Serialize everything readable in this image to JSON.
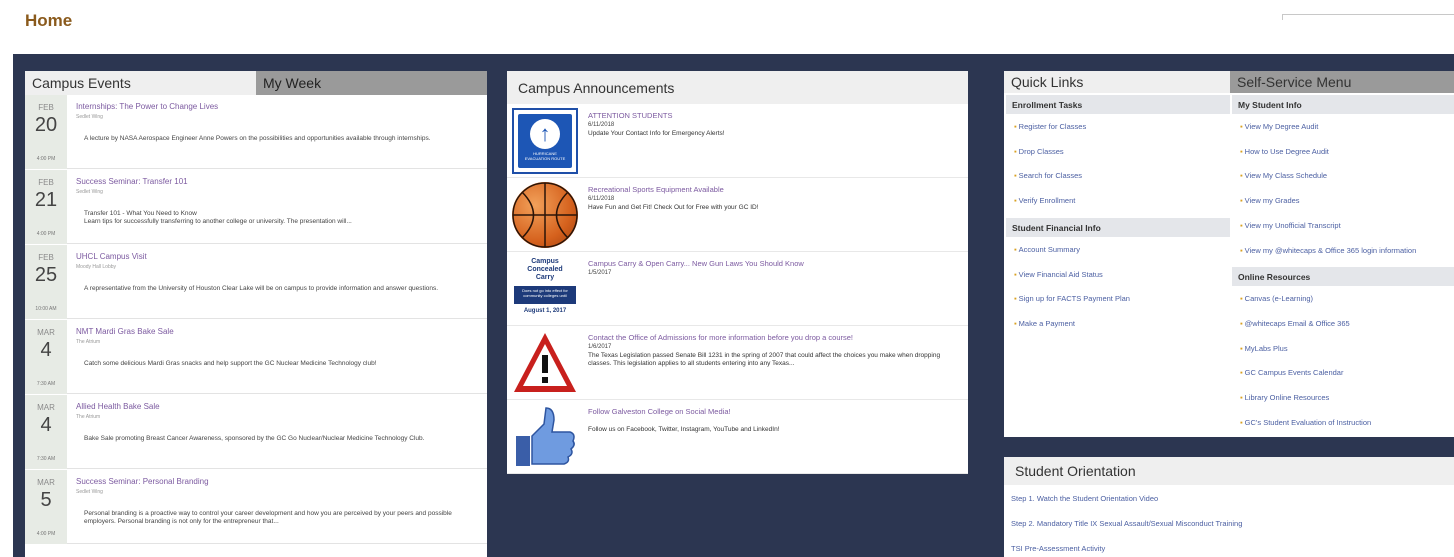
{
  "header": {
    "title": "Home"
  },
  "events": {
    "tabs": [
      "Campus Events",
      "My Week"
    ],
    "items": [
      {
        "mon": "FEB",
        "day": "20",
        "time": "4:00 PM",
        "title": "Internships: The Power to Change Lives",
        "loc": "Sedlet Wing",
        "desc": "A lecture by NASA Aerospace Engineer Anne Powers on the possibilities and opportunities available through internships."
      },
      {
        "mon": "FEB",
        "day": "21",
        "time": "4:00 PM",
        "title": "Success Seminar: Transfer 101",
        "loc": "Sedlet Wing",
        "desc": "Transfer 101 - What You Need to Know\nLearn tips for successfully transferring to another college or university. The presentation will..."
      },
      {
        "mon": "FEB",
        "day": "25",
        "time": "10:00 AM",
        "title": "UHCL Campus Visit",
        "loc": "Moody Hall Lobby",
        "desc": "A representative from the University of Houston Clear Lake will be on campus to provide information and answer questions."
      },
      {
        "mon": "MAR",
        "day": "4",
        "time": "7:30 AM",
        "title": "NMT Mardi Gras Bake Sale",
        "loc": "The Atrium",
        "desc": "Catch some delicious Mardi Gras snacks and help support the GC Nuclear Medicine Technology club!"
      },
      {
        "mon": "MAR",
        "day": "4",
        "time": "7:30 AM",
        "title": "Allied Health Bake Sale",
        "loc": "The Atrium",
        "desc": "Bake Sale promoting Breast Cancer Awareness, sponsored by the GC Go Nuclear/Nuclear Medicine Technology Club."
      },
      {
        "mon": "MAR",
        "day": "5",
        "time": "4:00 PM",
        "title": "Success Seminar: Personal Branding",
        "loc": "Sedlet Wing",
        "desc": "Personal branding is a proactive way to control your career development and how you are perceived by your peers and possible employers. Personal branding is not only for the entrepreneur that..."
      }
    ]
  },
  "announcements": {
    "title": "Campus Announcements",
    "items": [
      {
        "icon": "hurricane-evacuation-icon",
        "title": "ATTENTION STUDENTS",
        "date": "6/11/2018",
        "text": "Update Your Contact Info for Emergency Alerts!"
      },
      {
        "icon": "basketball-icon",
        "title": "Recreational Sports Equipment Available",
        "date": "6/11/2018",
        "text": "Have Fun and Get Fit! Check Out for Free with your GC ID!"
      },
      {
        "icon": "campus-carry-icon",
        "title": "Campus Carry & Open Carry... New Gun Laws You Should Know",
        "date": "1/5/2017",
        "text": ""
      },
      {
        "icon": "warning-icon",
        "title": "Contact the Office of Admissions for more information before you drop a course!",
        "date": "1/6/2017",
        "text": "The Texas Legislation passed Senate Bill 1231 in the spring of 2007 that could affect the choices you make when dropping classes. This legislation applies to all students entering into any Texas..."
      },
      {
        "icon": "thumbs-up-icon",
        "title": "Follow Galveston College on Social Media!",
        "date": "",
        "text": "Follow us on Facebook, Twitter, Instagram, YouTube and LinkedIn!"
      }
    ],
    "ccc": {
      "l1": "Campus",
      "l2": "Concealed",
      "l3": "Carry",
      "box": "Does not go into effect for community colleges until",
      "date": "August 1, 2017"
    },
    "hurricane_text": "HURRICANE EVACUATION ROUTE"
  },
  "quicklinks": {
    "tabs": [
      "Quick Links",
      "Self-Service Menu"
    ],
    "left_sections": [
      {
        "title": "Enrollment Tasks",
        "links": [
          "Register for Classes",
          "Drop Classes",
          "Search for Classes",
          "Verify Enrollment"
        ]
      },
      {
        "title": "Student Financial Info",
        "links": [
          "Account Summary",
          "View Financial Aid Status",
          "Sign up for FACTS Payment Plan",
          "Make a Payment"
        ]
      }
    ],
    "right_sections": [
      {
        "title": "My Student Info",
        "links": [
          "View My Degree Audit",
          "How to Use Degree Audit",
          "View My Class Schedule",
          "View my Grades",
          "View my Unofficial Transcript",
          "View my @whitecaps & Office 365 login information"
        ]
      },
      {
        "title": "Online Resources",
        "links": [
          "Canvas (e-Learning)",
          "@whitecaps Email & Office 365",
          "MyLabs Plus",
          "GC Campus Events Calendar",
          "Library Online Resources",
          "GC's Student Evaluation of Instruction"
        ]
      }
    ]
  },
  "orientation": {
    "title": "Student Orientation",
    "links": [
      "Step 1. Watch the Student Orientation Video",
      "Step 2. Mandatory Title IX Sexual Assault/Sexual Misconduct Training",
      "TSI Pre-Assessment Activity"
    ]
  }
}
